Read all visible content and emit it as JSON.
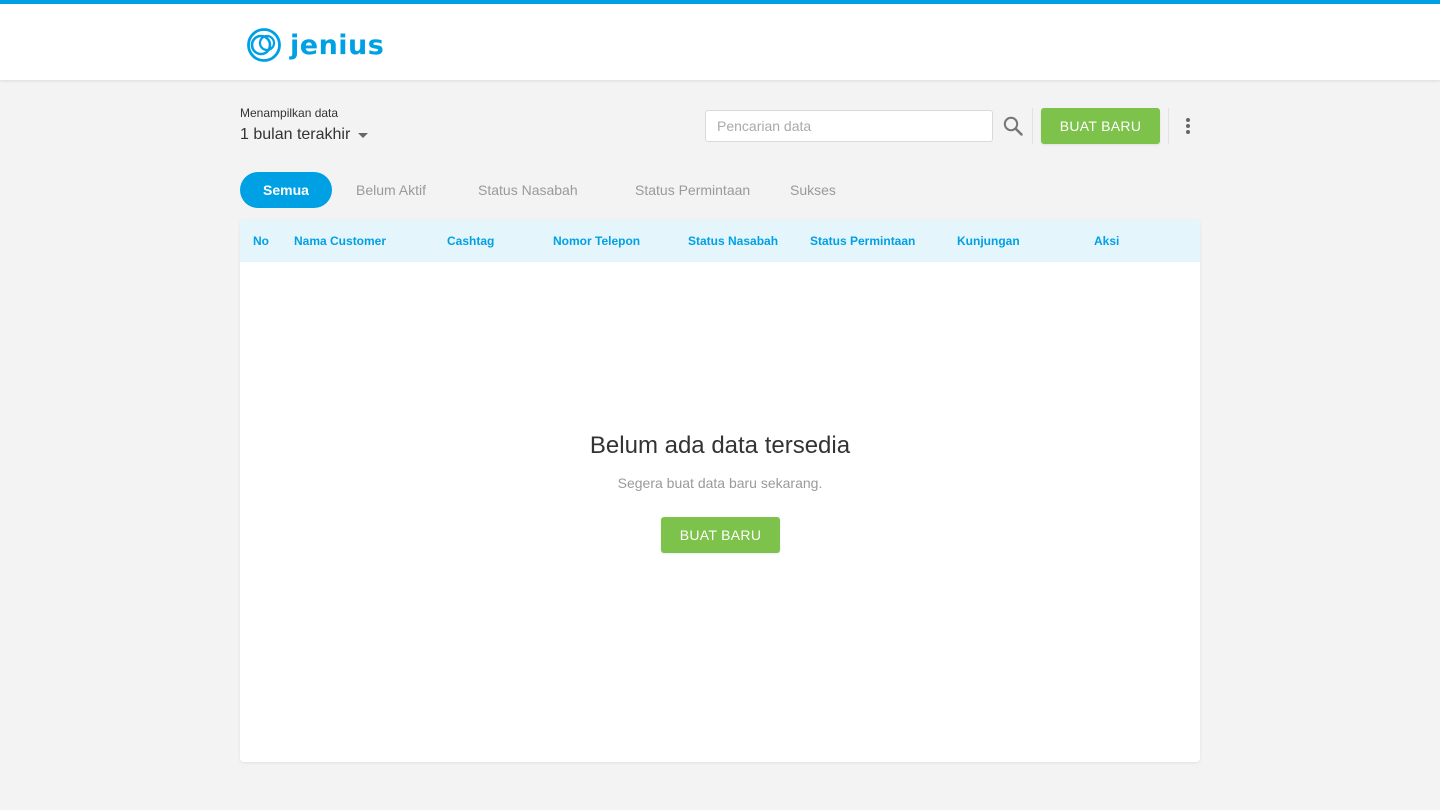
{
  "brand": {
    "name": "jenius",
    "color": "#00a1e4"
  },
  "filter": {
    "label": "Menampilkan data",
    "value": "1 bulan terakhir"
  },
  "search": {
    "placeholder": "Pencarian data",
    "icon": "search-icon"
  },
  "actions": {
    "create_label": "BUAT BARU",
    "more_icon": "more-vertical-icon",
    "accent": "#7dc24b"
  },
  "tabs": [
    {
      "label": "Semua",
      "active": true
    },
    {
      "label": "Belum Aktif"
    },
    {
      "label": "Status Nasabah"
    },
    {
      "label": "Status Permintaan"
    },
    {
      "label": "Sukses"
    }
  ],
  "table": {
    "columns": [
      "No",
      "Nama Customer",
      "Cashtag",
      "Nomor Telepon",
      "Status Nasabah",
      "Status Permintaan",
      "Kunjungan",
      "Aksi"
    ],
    "rows": []
  },
  "empty": {
    "title": "Belum ada data tersedia",
    "subtitle": "Segera buat data baru sekarang.",
    "button_label": "BUAT BARU"
  }
}
